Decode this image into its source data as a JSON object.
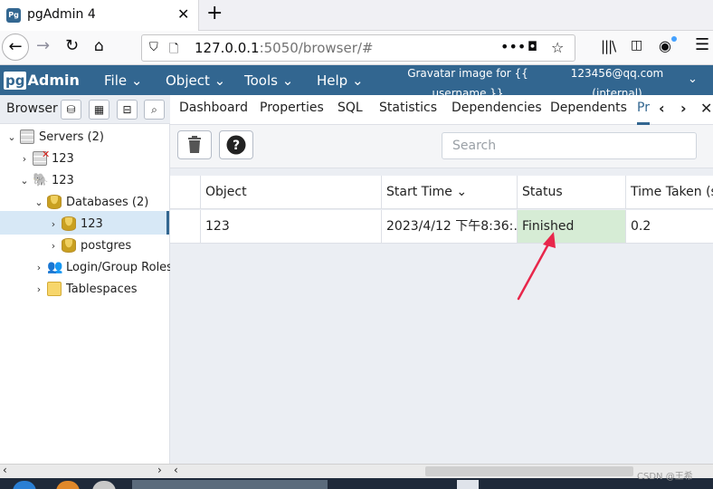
{
  "window": {
    "tab_title": "pgAdmin 4",
    "favicon_text": "Pg",
    "tab_close": "✕",
    "new_tab": "+"
  },
  "navbar": {
    "url_host": "127.0.0.1",
    "url_rest": ":5050/browser/#",
    "dots": "•••"
  },
  "pg_header": {
    "logo_box": "pg",
    "logo_text": "Admin",
    "menus": [
      "File",
      "Object",
      "Tools",
      "Help"
    ],
    "gravatar_line1": "Gravatar image for {{",
    "gravatar_line2": "username }}",
    "user_line1": "123456@qq.com",
    "user_line2": "(internal)"
  },
  "browser_panel": {
    "title": "Browser",
    "tree": [
      {
        "label": "Servers (2)",
        "arrow": "⌄"
      },
      {
        "label": "123",
        "arrow": "›"
      },
      {
        "label": "123",
        "arrow": "⌄"
      },
      {
        "label": "Databases (2)",
        "arrow": "⌄"
      },
      {
        "label": "123",
        "arrow": "›"
      },
      {
        "label": "postgres",
        "arrow": "›"
      },
      {
        "label": "Login/Group Roles",
        "arrow": "›"
      },
      {
        "label": "Tablespaces",
        "arrow": "›"
      }
    ]
  },
  "main_tabs": {
    "tabs": [
      "Dashboard",
      "Properties",
      "SQL",
      "Statistics",
      "Dependencies",
      "Dependents",
      "Pr"
    ],
    "active_index": 6
  },
  "process_panel": {
    "search_placeholder": "Search",
    "columns": [
      "Object",
      "Start Time",
      "Status",
      "Time Taken (s"
    ],
    "rows": [
      {
        "object": "123",
        "start_time": "2023/4/12 下午8:36:…",
        "status": "Finished",
        "time_taken": "0.2"
      }
    ],
    "status_color": "#d6ecd5"
  },
  "colors": {
    "pg_header": "#326690",
    "annotation_arrow": "#e8274b"
  },
  "watermark": "CSDN @王希"
}
